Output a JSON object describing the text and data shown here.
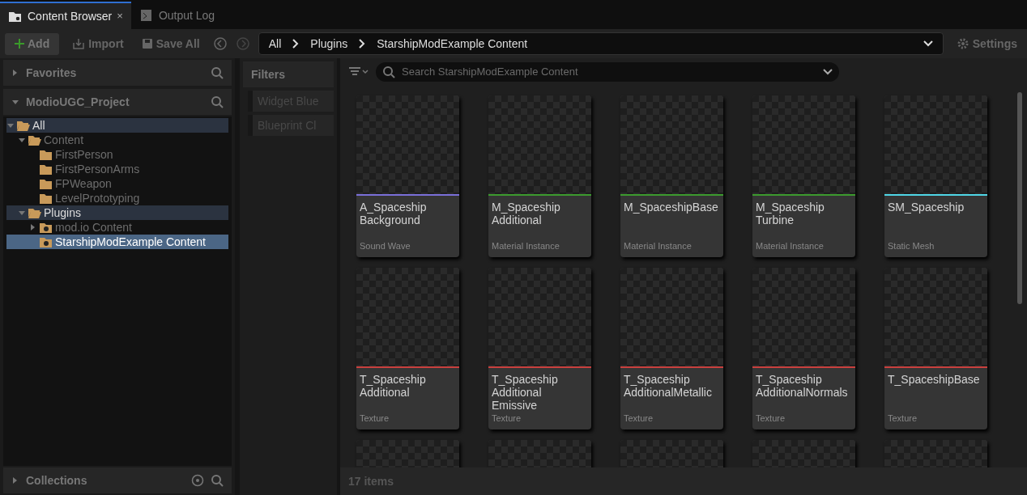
{
  "tabs": [
    {
      "label": "Content Browser",
      "selected": true,
      "close": "×"
    },
    {
      "label": "Output Log",
      "selected": false
    }
  ],
  "toolbar": {
    "add": "Add",
    "import": "Import",
    "save_all": "Save All",
    "breadcrumb": [
      "All",
      "Plugins",
      "StarshipModExample Content"
    ],
    "settings": "Settings"
  },
  "sources": {
    "favorites": {
      "title": "Favorites",
      "expanded": false
    },
    "project": {
      "title": "ModioUGC_Project",
      "expanded": true
    },
    "tree": [
      {
        "label": "All",
        "expanded": true,
        "selected": false,
        "highlighted": true,
        "children": [
          {
            "label": "Content",
            "expanded": true,
            "selected": false,
            "highlighted": false,
            "children": [
              {
                "label": "FirstPerson",
                "expanded": false,
                "selected": false,
                "highlighted": false
              },
              {
                "label": "FirstPersonArms",
                "expanded": false,
                "selected": false,
                "highlighted": false
              },
              {
                "label": "FPWeapon",
                "expanded": false,
                "selected": false,
                "highlighted": false
              },
              {
                "label": "LevelPrototyping",
                "expanded": false,
                "selected": false,
                "highlighted": false
              }
            ]
          },
          {
            "label": "Plugins",
            "expanded": true,
            "selected": false,
            "highlighted": true,
            "children": [
              {
                "label": "mod.io Content",
                "expanded": false,
                "selected": false,
                "highlighted": false,
                "plugin": true,
                "expandable": true
              },
              {
                "label": "StarshipModExample Content",
                "expanded": false,
                "selected": true,
                "highlighted": false,
                "plugin": true,
                "expandable": false
              }
            ]
          }
        ]
      }
    ],
    "collections": {
      "title": "Collections",
      "expanded": false
    }
  },
  "filters": {
    "title": "Filters",
    "items": [
      "Widget Blue",
      "Blueprint Cl"
    ]
  },
  "search": {
    "placeholder": "Search StarshipModExample Content"
  },
  "assets": [
    {
      "kind": "tile",
      "name": "A_Spaceship Background",
      "type": "Sound Wave",
      "color": "#7a6fd8"
    },
    {
      "kind": "tile",
      "name": "M_Spaceship Additional",
      "type": "Material Instance",
      "color": "#3c9a2e"
    },
    {
      "kind": "tile",
      "name": "M_SpaceshipBase",
      "type": "Material Instance",
      "color": "#3c9a2e"
    },
    {
      "kind": "tile",
      "name": "M_Spaceship Turbine",
      "type": "Material Instance",
      "color": "#3c9a2e"
    },
    {
      "kind": "tile",
      "name": "SM_Spaceship",
      "type": "Static Mesh",
      "color": "#4fd6e6"
    },
    {
      "kind": "tile",
      "name": "T_Spaceship Additional",
      "type": "Texture",
      "color": "#c9403e"
    },
    {
      "kind": "tile",
      "name": "T_Spaceship Additional Emissive",
      "type": "Texture",
      "color": "#c9403e"
    },
    {
      "kind": "tile",
      "name": "T_Spaceship AdditionalMetallic",
      "type": "Texture",
      "color": "#c9403e"
    },
    {
      "kind": "tile",
      "name": "T_Spaceship AdditionalNormals",
      "type": "Texture",
      "color": "#c9403e"
    },
    {
      "kind": "tile",
      "name": "T_SpaceshipBase",
      "type": "Texture",
      "color": "#c9403e"
    },
    {
      "kind": "partial"
    },
    {
      "kind": "partial"
    },
    {
      "kind": "partial"
    },
    {
      "kind": "partial"
    },
    {
      "kind": "partial"
    }
  ],
  "status_bar": {
    "count": "17 items"
  }
}
